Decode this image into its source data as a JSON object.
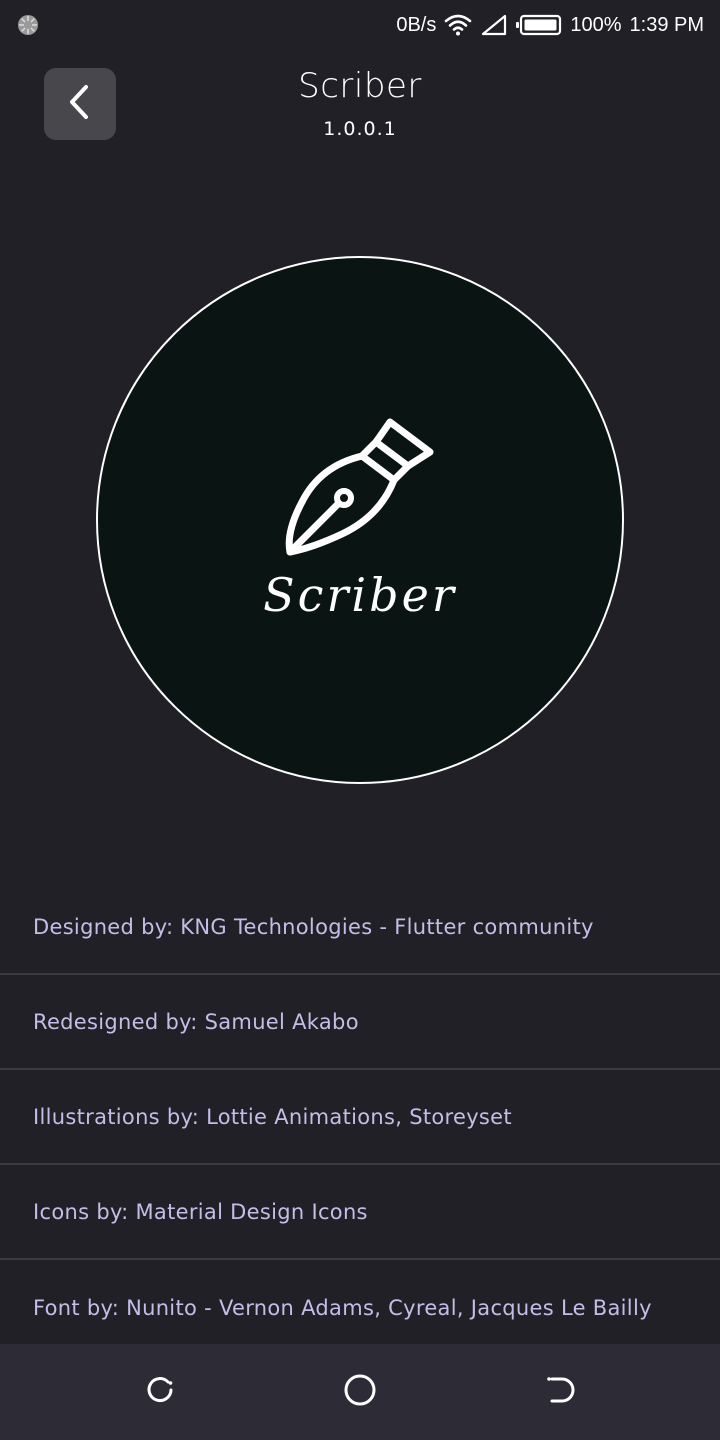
{
  "status_bar": {
    "net_speed": "0B/s",
    "battery": "100%",
    "time": "1:39 PM",
    "icons": [
      "loading-spinner-icon",
      "wifi-icon",
      "signal-icon",
      "battery-icon"
    ]
  },
  "header": {
    "title": "Scriber",
    "version": "1.0.0.1",
    "back_icon": "chevron-left-icon"
  },
  "logo": {
    "text": "Scriber",
    "icon": "fountain-pen-icon"
  },
  "credits": [
    "Designed by: KNG Technologies - Flutter community",
    "Redesigned by: Samuel Akabo",
    "Illustrations by: Lottie Animations, Storeyset",
    "Icons by: Material Design Icons",
    "Font by: Nunito - Vernon Adams, Cyreal, Jacques Le Bailly"
  ],
  "nav_bar": {
    "icons": [
      "recent-apps-icon",
      "home-icon",
      "back-icon"
    ]
  },
  "colors": {
    "background": "#212026",
    "credit_text": "#c5bce8",
    "logo_fill": "#0a1413",
    "button_bg": "#48474c",
    "nav_bg": "#2d2b36"
  }
}
